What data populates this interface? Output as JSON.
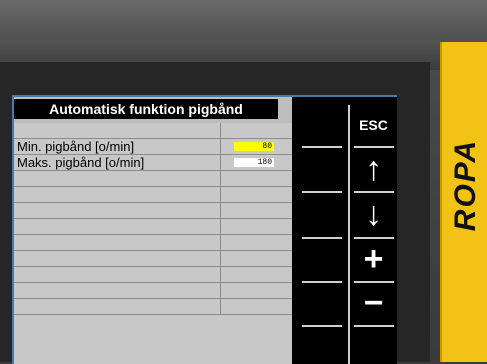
{
  "device": {
    "logo": "ROPA"
  },
  "screen": {
    "title": "Automatisk funktion pigbånd",
    "rows": [
      {
        "label": "",
        "value": ""
      },
      {
        "label": "Min. pigbånd [o/min]",
        "value": "80"
      },
      {
        "label": "Maks. pigbånd [o/min]",
        "value": "180"
      },
      {
        "label": "",
        "value": ""
      },
      {
        "label": "",
        "value": ""
      },
      {
        "label": "",
        "value": ""
      },
      {
        "label": "",
        "value": ""
      },
      {
        "label": "",
        "value": ""
      },
      {
        "label": "",
        "value": ""
      },
      {
        "label": "",
        "value": ""
      },
      {
        "label": "",
        "value": ""
      },
      {
        "label": "",
        "value": ""
      }
    ]
  },
  "softkeys": {
    "esc": "ESC",
    "up": "↑",
    "down": "↓",
    "plus": "+",
    "minus": "−"
  },
  "colors": {
    "min_value_bg": "#ffff00",
    "max_value_bg": "#ffffff",
    "housing_accent": "#f2c215"
  }
}
